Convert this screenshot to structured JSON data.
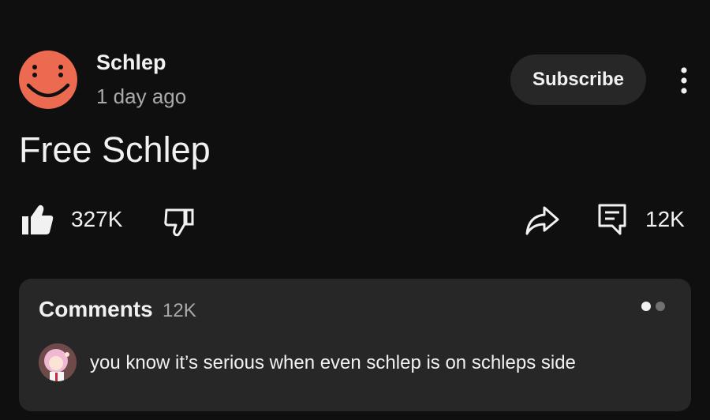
{
  "post": {
    "channel_name": "Schlep",
    "time": "1 day ago",
    "text": "Free Schlep",
    "subscribe_label": "Subscribe"
  },
  "actions": {
    "like_count": "327K",
    "comment_count": "12K"
  },
  "comments": {
    "title": "Comments",
    "count": "12K",
    "top_comment": "you know it’s serious when even schlep is on schleps side"
  },
  "colors": {
    "background": "#0f0f0f",
    "card": "#272727",
    "avatar": "#ec6a4f",
    "secondary_text": "#aaaaaa"
  },
  "icons": {
    "avatar": "smiley-face-icon",
    "like": "thumbs-up-filled-icon",
    "dislike": "thumbs-down-outline-icon",
    "share": "share-arrow-icon",
    "comment": "comment-icon",
    "more": "vertical-dots-icon"
  }
}
